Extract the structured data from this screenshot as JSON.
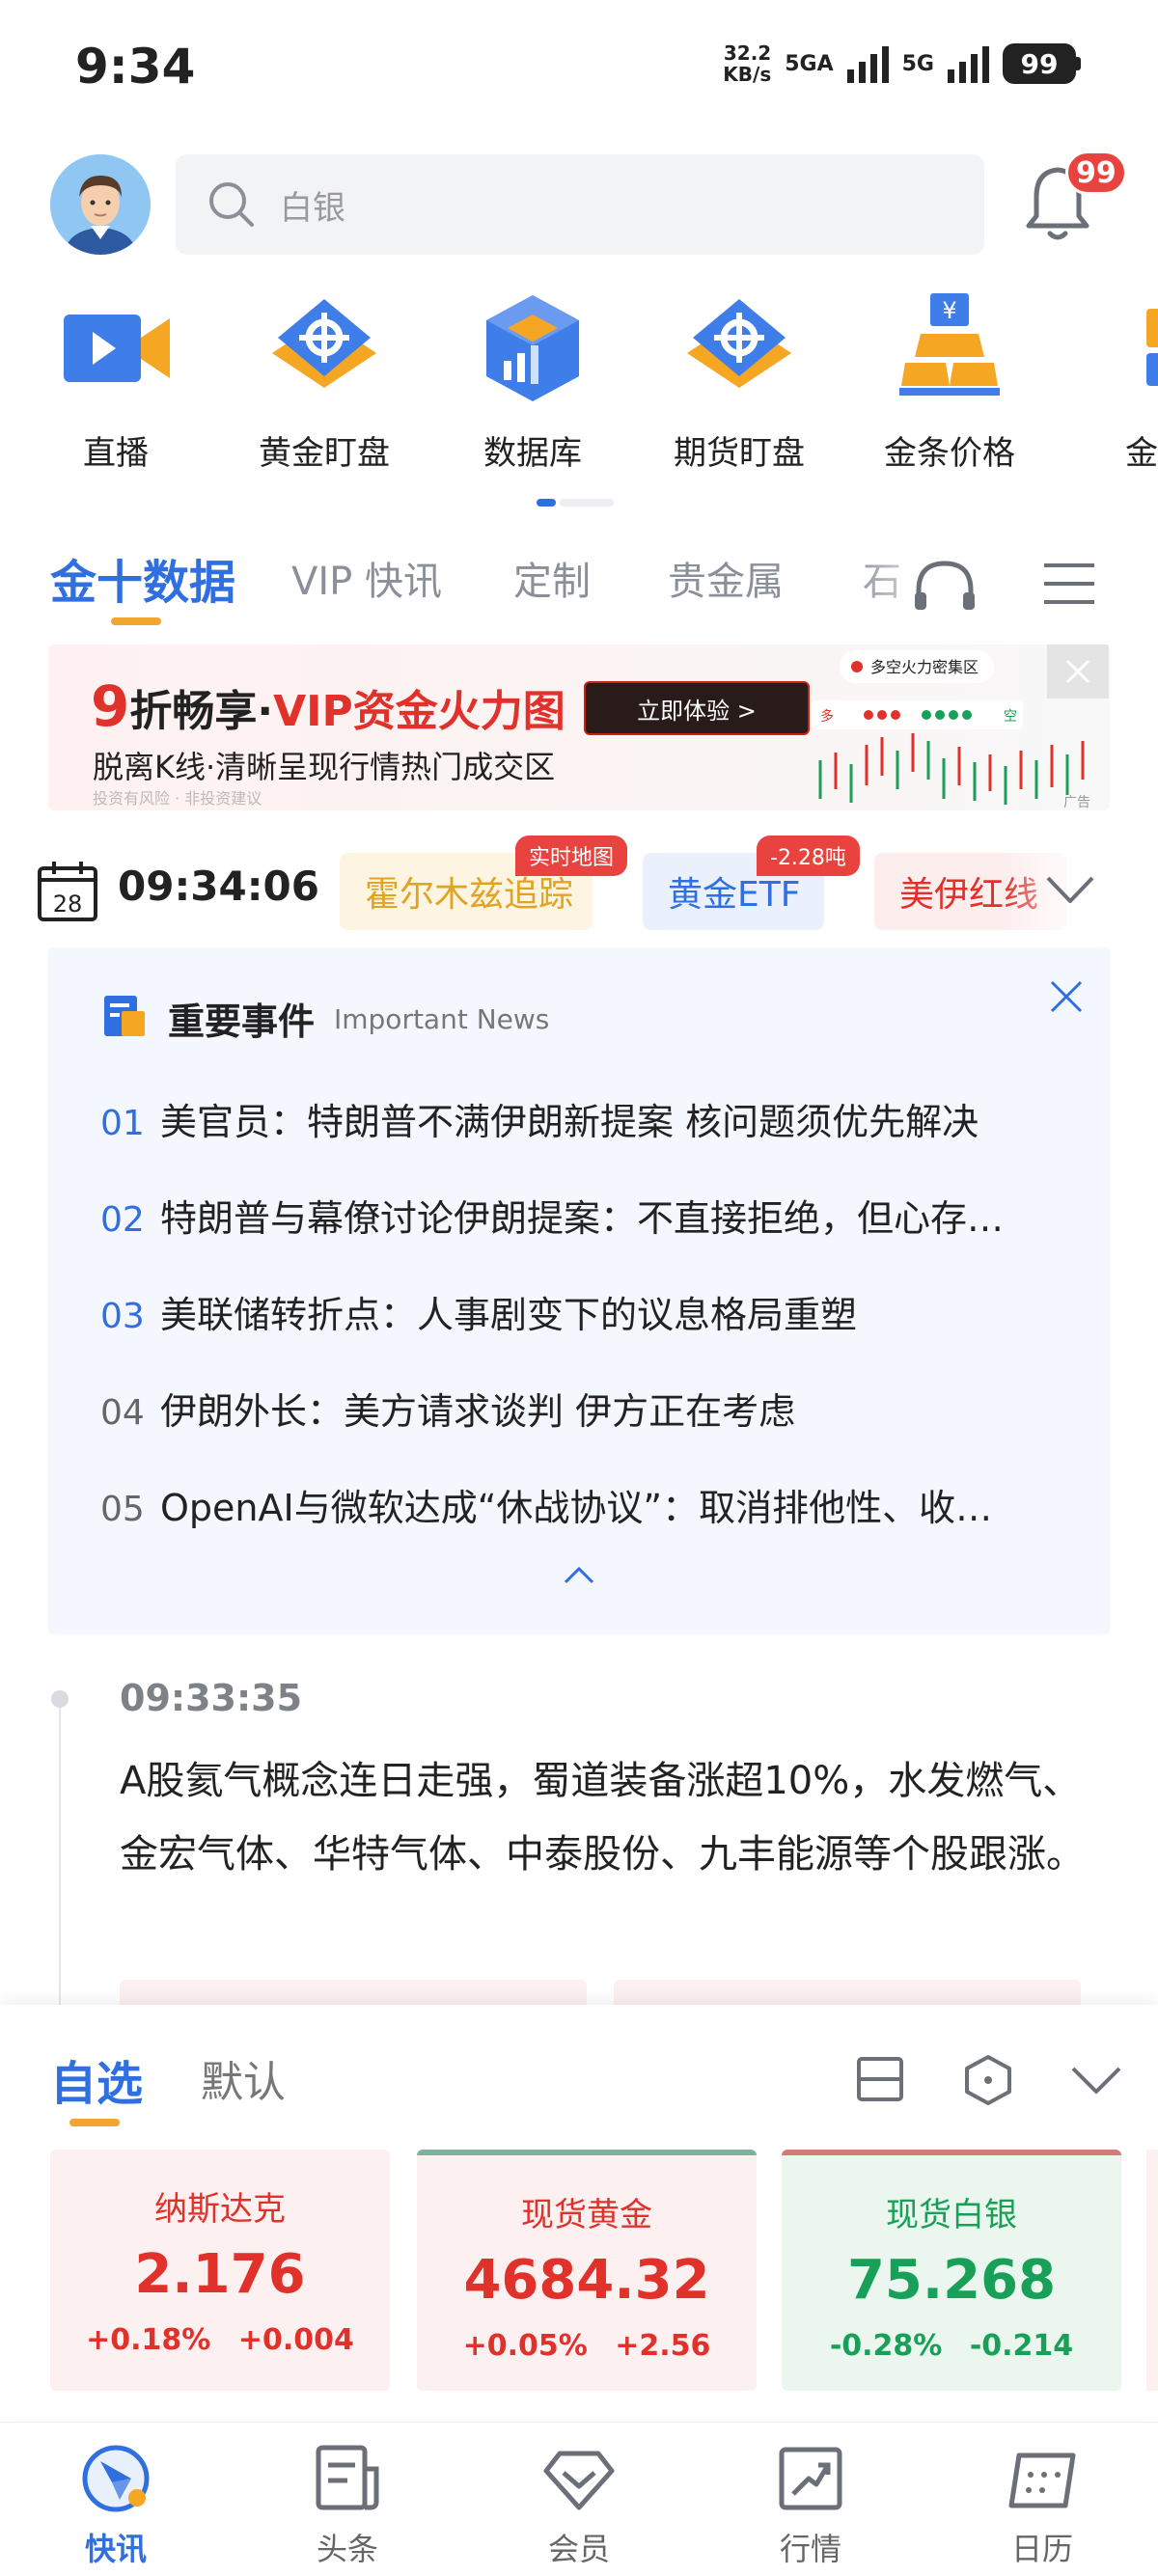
{
  "status_bar": {
    "time": "9:34",
    "net_speed_value": "32.2",
    "net_speed_unit": "KB/s",
    "net_type_1": "5GA",
    "net_type_2": "5G",
    "battery": "99"
  },
  "header": {
    "search_placeholder": "白银",
    "notification_count": "99"
  },
  "quick_menu": {
    "items": [
      {
        "label": "直播",
        "icon": "live-video-icon"
      },
      {
        "label": "黄金盯盘",
        "icon": "gold-watch-icon"
      },
      {
        "label": "数据库",
        "icon": "database-cube-icon"
      },
      {
        "label": "期货盯盘",
        "icon": "futures-watch-icon"
      },
      {
        "label": "金条价格",
        "icon": "gold-bar-icon"
      },
      {
        "label": "金银",
        "icon": "gold-silver-icon"
      }
    ]
  },
  "tabs": {
    "items": [
      "金十数据",
      "VIP 快讯",
      "定制",
      "贵金属",
      "石"
    ],
    "active_index": 0
  },
  "banner": {
    "prefix_number": "9",
    "line1_part1": "折畅享·",
    "line1_part2": "VIP资金火力图",
    "button": "立即体验 >",
    "line2": "脱离K线·清晰呈现行情热门成交区",
    "disclaimer": "投资有风险 · 非投资建议",
    "chart_caption": "多空火力密集区",
    "chart_side_long": "多",
    "chart_side_short": "空",
    "ad_tag": "广告"
  },
  "topic_bar": {
    "calendar_day": "28",
    "clock": "09:34:06",
    "chips": [
      {
        "label": "霍尔木兹追踪",
        "badge": "实时地图"
      },
      {
        "label": "黄金ETF",
        "badge": "-2.28吨"
      },
      {
        "label": "美伊红线",
        "badge": ""
      }
    ]
  },
  "important_news": {
    "title": "重要事件",
    "subtitle": "Important News",
    "items": [
      {
        "num": "01",
        "text": "美官员：特朗普不满伊朗新提案 核问题须优先解决"
      },
      {
        "num": "02",
        "text": "特朗普与幕僚讨论伊朗提案：不直接拒绝，但心存…"
      },
      {
        "num": "03",
        "text": "美联储转折点：人事剧变下的议息格局重塑"
      },
      {
        "num": "04",
        "text": "伊朗外长：美方请求谈判 伊方正在考虑"
      },
      {
        "num": "05",
        "text": "OpenAI与微软达成“休战协议”：取消排他性、收…"
      }
    ]
  },
  "feed": {
    "time": "09:33:35",
    "text": "A股氦气概念连日走强，蜀道装备涨超10%，水发燃气、金宏气体、华特气体、中泰股份、九丰能源等个股跟涨。"
  },
  "watchlist": {
    "tabs": [
      "自选",
      "默认"
    ],
    "quotes": [
      {
        "name": "纳斯达克",
        "price": "2.176",
        "pct": "+0.18%",
        "change": "+0.004",
        "trend": "up"
      },
      {
        "name": "现货黄金",
        "price": "4684.32",
        "pct": "+0.05%",
        "change": "+2.56",
        "trend": "up"
      },
      {
        "name": "现货白银",
        "price": "75.268",
        "pct": "-0.28%",
        "change": "-0.214",
        "trend": "down"
      }
    ]
  },
  "bottom_nav": {
    "items": [
      {
        "label": "快讯",
        "icon": "flash-news-icon"
      },
      {
        "label": "头条",
        "icon": "headlines-icon"
      },
      {
        "label": "会员",
        "icon": "member-diamond-icon"
      },
      {
        "label": "行情",
        "icon": "market-chart-icon"
      },
      {
        "label": "日历",
        "icon": "calendar-icon"
      }
    ],
    "active_index": 0
  },
  "colors": {
    "accent_blue": "#2f6fe0",
    "up_red": "#e0312b",
    "down_green": "#18a058",
    "tab_underline": "#f2a530"
  }
}
